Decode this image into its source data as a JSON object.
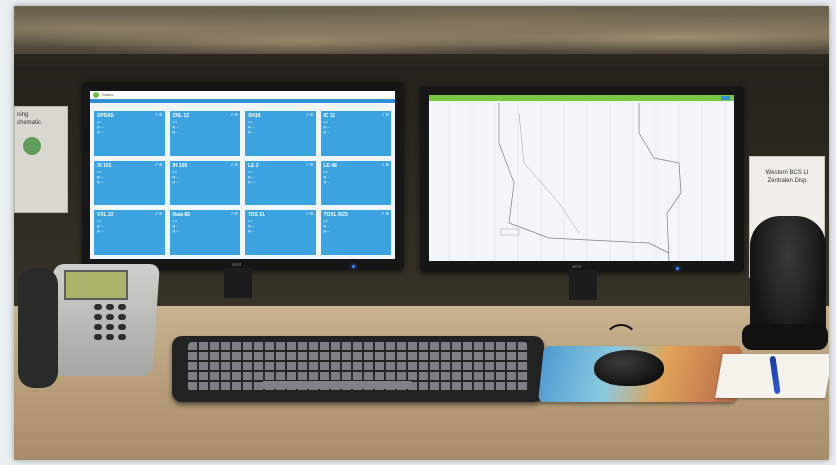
{
  "colors": {
    "tile_blue": "#3aa3e0",
    "graph_green": "#7ac943",
    "led_blue": "#3d8bff"
  },
  "left_monitor": {
    "brand": "acer",
    "dashboard": {
      "app_title": "Status",
      "tiles": [
        {
          "title": "XPDA5",
          "lines": [
            "0",
            "—",
            "—"
          ]
        },
        {
          "title": "ZHL 12",
          "lines": [
            "0",
            "—",
            "—"
          ]
        },
        {
          "title": "XH16",
          "lines": [
            "0",
            "—",
            "—"
          ]
        },
        {
          "title": "IC 11",
          "lines": [
            "0",
            "—",
            "—"
          ]
        },
        {
          "title": "XI 101",
          "lines": [
            "0",
            "—",
            "—"
          ]
        },
        {
          "title": "IH 105",
          "lines": [
            "0",
            "—",
            "—"
          ]
        },
        {
          "title": "LE 2",
          "lines": [
            "0",
            "—",
            "—"
          ]
        },
        {
          "title": "LE 48",
          "lines": [
            "0",
            "—",
            "—"
          ]
        },
        {
          "title": "VXL 22",
          "lines": [
            "0",
            "—",
            "—"
          ]
        },
        {
          "title": "Rala 65",
          "lines": [
            "0",
            "—",
            "—"
          ]
        },
        {
          "title": "TDS 51",
          "lines": [
            "0",
            "—",
            "—"
          ]
        },
        {
          "title": "TOXL 9/23",
          "lines": [
            "0",
            "—",
            "—"
          ]
        }
      ]
    }
  },
  "right_monitor": {
    "brand": "acer"
  },
  "posters": {
    "left_text": "ning\nchematic",
    "right_text": "Western BCS LI\nZentralen Disp"
  },
  "phone": {
    "display_text": ""
  }
}
